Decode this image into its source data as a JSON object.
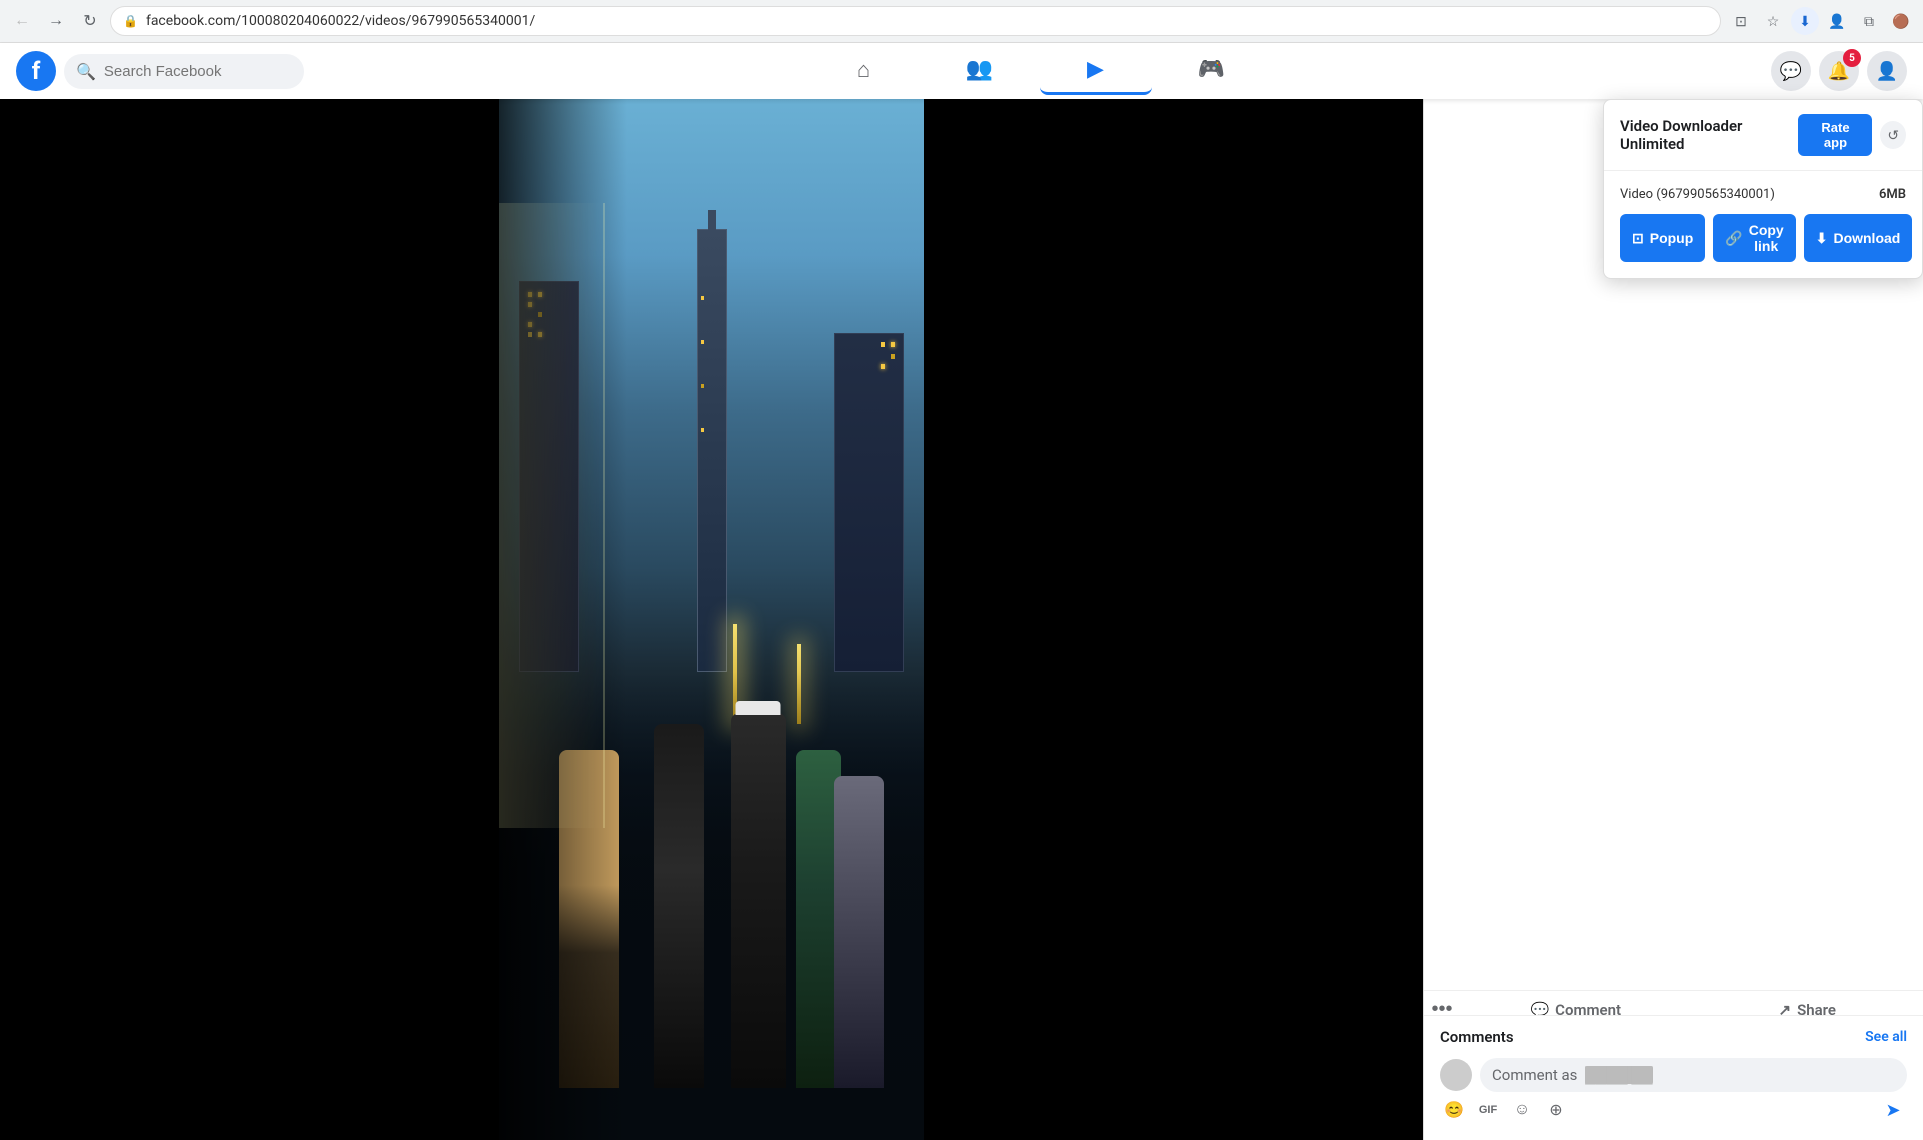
{
  "browser": {
    "url": "facebook.com/100080204060022/videos/967990565340001/",
    "back_tooltip": "Back",
    "forward_tooltip": "Forward",
    "reload_tooltip": "Reload",
    "actions": [
      "cast",
      "bookmark",
      "extension-highlight",
      "profile-icon",
      "extensions-menu",
      "user-profile"
    ]
  },
  "facebook": {
    "logo_letter": "f",
    "search_placeholder": "Search Facebook",
    "nav_items": [
      {
        "id": "home",
        "icon": "⌂",
        "active": false
      },
      {
        "id": "friends",
        "icon": "👥",
        "active": false
      },
      {
        "id": "video",
        "icon": "▶",
        "active": true
      },
      {
        "id": "gaming",
        "icon": "🎮",
        "active": false
      }
    ],
    "header_icons": {
      "messenger": "💬",
      "notifications": "🔔",
      "notification_count": "5"
    }
  },
  "extension": {
    "title": "Video Downloader Unlimited",
    "rate_btn_label": "Rate app",
    "close_btn": "↺",
    "video_id": "Video (967990565340001)",
    "file_size": "6MB",
    "buttons": {
      "popup_label": "Popup",
      "copy_link_label": "Copy link",
      "download_label": "Download"
    }
  },
  "post_actions": {
    "comment_label": "Comment",
    "share_label": "Share"
  },
  "comments": {
    "title": "Comments",
    "see_all_label": "See all",
    "input_placeholder": "Comment as",
    "username_placeholder": "▓▓▓▓▓▓ ▓▓"
  },
  "icons": {
    "search": "🔍",
    "popup": "⊡",
    "copy": "🔗",
    "download": "⬇",
    "emoji": "😊",
    "gif": "GIF",
    "sticker": "🎭",
    "more": "⋯",
    "send": "➤",
    "three_dots": "•••"
  }
}
